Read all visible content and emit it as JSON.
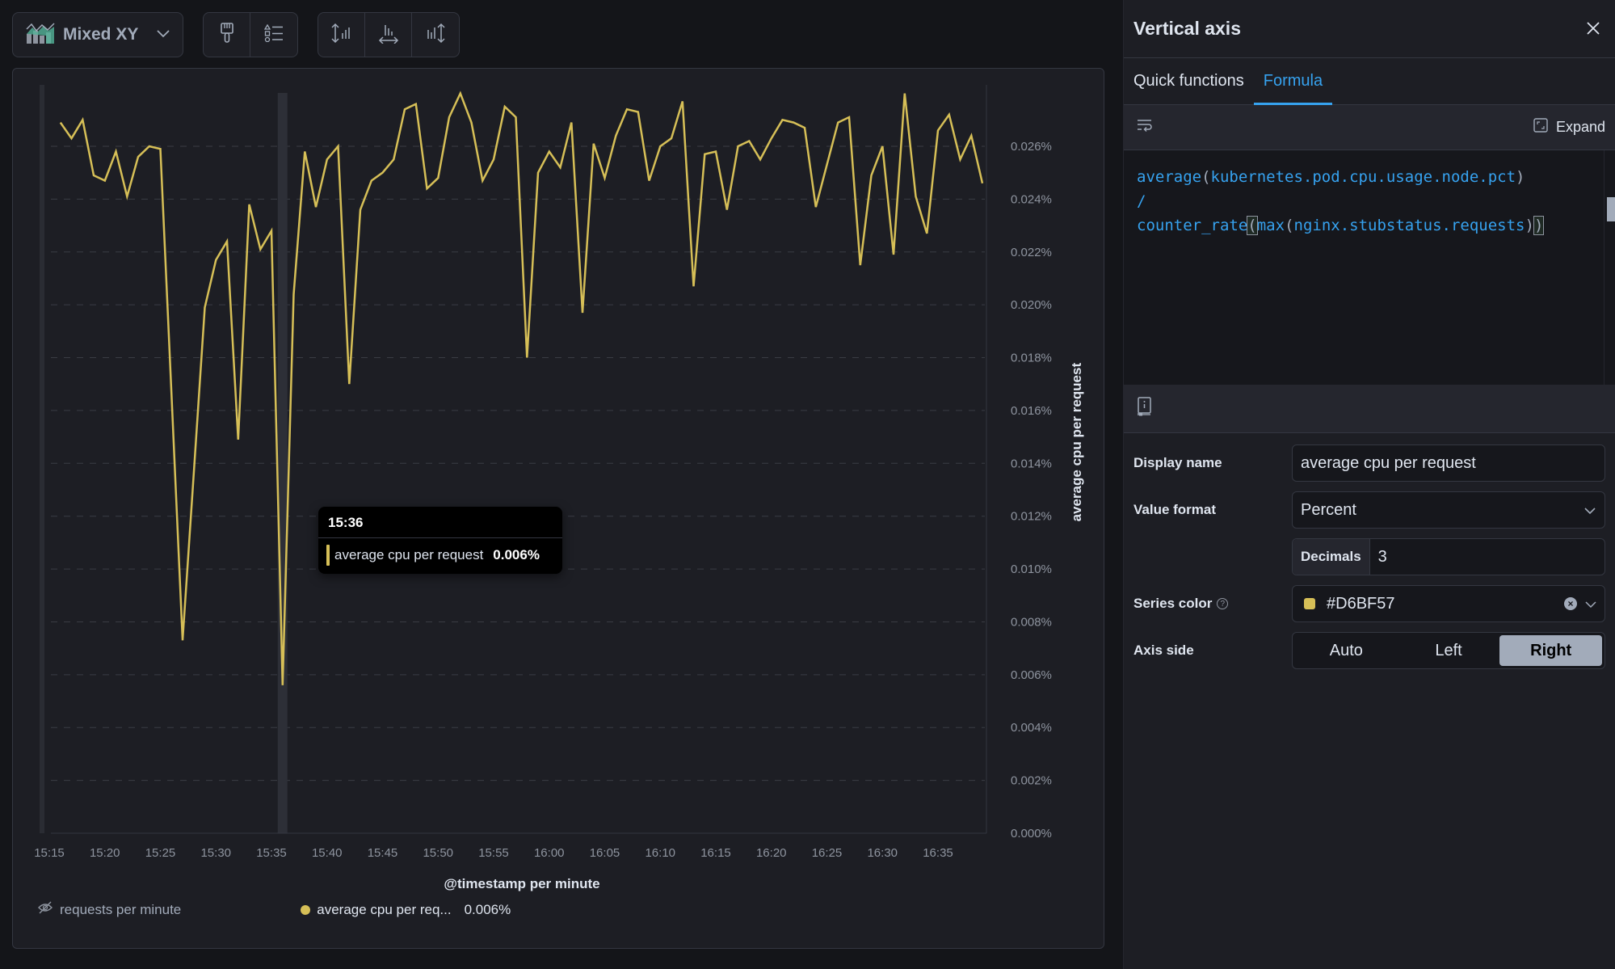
{
  "toolbar": {
    "chart_type_label": "Mixed XY",
    "chart_type_icon": "mixed-xy-chart-icon",
    "style_buttons": [
      {
        "name": "visual-options-button",
        "icon": "paintbrush-icon"
      },
      {
        "name": "legend-options-button",
        "icon": "legend-list-icon"
      }
    ],
    "axis_buttons": [
      {
        "name": "left-axis-button",
        "icon": "left-axis-icon"
      },
      {
        "name": "bottom-axis-button",
        "icon": "bottom-axis-icon"
      },
      {
        "name": "right-axis-button",
        "icon": "right-axis-icon"
      }
    ]
  },
  "chart_data": {
    "type": "line",
    "title": "",
    "xlabel": "@timestamp per minute",
    "ylabel": "average cpu per request",
    "y_axis_side": "right",
    "ylim": [
      0,
      0.028
    ],
    "y_unit": "%",
    "y_ticks": [
      "0.000%",
      "0.002%",
      "0.004%",
      "0.006%",
      "0.008%",
      "0.010%",
      "0.012%",
      "0.014%",
      "0.016%",
      "0.018%",
      "0.020%",
      "0.022%",
      "0.024%",
      "0.026%"
    ],
    "y_tick_values": [
      0,
      0.002,
      0.004,
      0.006,
      0.008,
      0.01,
      0.012,
      0.014,
      0.016,
      0.018,
      0.02,
      0.022,
      0.024,
      0.026
    ],
    "x_ticks": [
      "15:15",
      "15:20",
      "15:25",
      "15:30",
      "15:35",
      "15:40",
      "15:45",
      "15:50",
      "15:55",
      "16:00",
      "16:05",
      "16:10",
      "16:15",
      "16:20",
      "16:25",
      "16:30",
      "16:35"
    ],
    "x_start": "15:16",
    "x_interval_minutes": 1,
    "grid": true,
    "legend_position": "bottom-left",
    "highlighted_x": "15:36",
    "series": [
      {
        "name": "average cpu per request",
        "color": "#D6BF57",
        "values": [
          0.0269,
          0.0263,
          0.027,
          0.0249,
          0.0247,
          0.0258,
          0.0241,
          0.0256,
          0.026,
          0.0259,
          0.0166,
          0.0073,
          0.0136,
          0.0199,
          0.0217,
          0.0224,
          0.0149,
          0.0238,
          0.0221,
          0.0228,
          0.0056,
          0.0204,
          0.0258,
          0.0237,
          0.0255,
          0.026,
          0.017,
          0.0236,
          0.0247,
          0.025,
          0.0255,
          0.0274,
          0.0276,
          0.0244,
          0.0248,
          0.0271,
          0.028,
          0.0269,
          0.0247,
          0.0255,
          0.0275,
          0.0271,
          0.018,
          0.025,
          0.0258,
          0.0252,
          0.0269,
          0.0197,
          0.0261,
          0.0248,
          0.0264,
          0.0274,
          0.0273,
          0.0247,
          0.026,
          0.0263,
          0.0277,
          0.0207,
          0.0257,
          0.0258,
          0.0236,
          0.026,
          0.0262,
          0.0255,
          0.0263,
          0.027,
          0.0269,
          0.0267,
          0.0237,
          0.0253,
          0.0269,
          0.0271,
          0.0215,
          0.0249,
          0.026,
          0.0219,
          0.028,
          0.0241,
          0.0227,
          0.0266,
          0.0272,
          0.0255,
          0.0264,
          0.0246
        ]
      }
    ]
  },
  "tooltip": {
    "time": "15:36",
    "series_label": "average cpu per request",
    "value": "0.006%"
  },
  "legend": {
    "hidden_item": {
      "label": "requests per minute",
      "icon": "eye-closed-icon"
    },
    "active_item": {
      "label": "average cpu per req...",
      "value": "0.006%"
    }
  },
  "side_panel": {
    "title": "Vertical axis",
    "close_icon": "close-icon",
    "tabs": [
      {
        "label": "Quick functions",
        "active": false
      },
      {
        "label": "Formula",
        "active": true
      }
    ],
    "editor": {
      "wrap_icon": "word-wrap-icon",
      "expand_label": "Expand",
      "formula_lines": [
        "average(kubernetes.pod.cpu.usage.node.pct)",
        "/",
        "counter_rate(max(nginx.stubstatus.requests))"
      ]
    },
    "doc_icon": "documentation-book-icon",
    "form": {
      "display_name_label": "Display name",
      "display_name_value": "average cpu per request",
      "value_format_label": "Value format",
      "value_format_value": "Percent",
      "decimals_label": "Decimals",
      "decimals_value": "3",
      "series_color_label": "Series color",
      "series_color_value": "#D6BF57",
      "axis_side_label": "Axis side",
      "axis_side_options": [
        "Auto",
        "Left",
        "Right"
      ],
      "axis_side_selected": "Right"
    }
  }
}
